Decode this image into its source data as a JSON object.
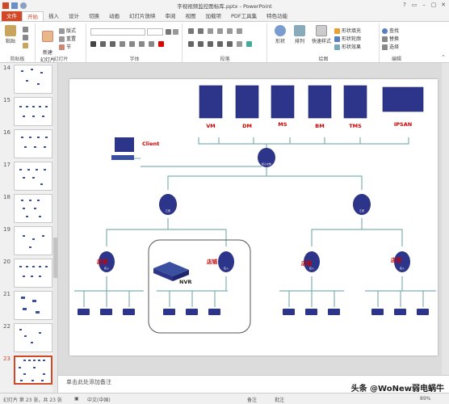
{
  "window": {
    "title": "字视视频监控图标库.pptx - PowerPoint",
    "controls": [
      "?",
      "▭",
      "–",
      "▢",
      "✕"
    ]
  },
  "tabs": [
    "文件",
    "开始",
    "插入",
    "设计",
    "切换",
    "动画",
    "幻灯片放映",
    "审阅",
    "视图",
    "加载项",
    "PDF工具集",
    "特色功能"
  ],
  "ribbon": {
    "clipboard": {
      "label": "剪贴板",
      "paste": "粘贴"
    },
    "slides": {
      "label": "幻灯片",
      "new_slide": "新建\n幻灯片",
      "layout": "版式",
      "reset": "重置",
      "section": "节"
    },
    "font": {
      "label": "字体"
    },
    "paragraph": {
      "label": "段落"
    },
    "drawing": {
      "label": "绘图",
      "shapes": "形状",
      "arrange": "排列",
      "quick_styles": "快速样式",
      "fill": "形状填充",
      "outline": "形状轮廓",
      "effect": "形状效果"
    },
    "editing": {
      "label": "编辑",
      "find": "查找",
      "replace": "替换",
      "select": "选择"
    }
  },
  "thumbnails": [
    "14",
    "15",
    "16",
    "17",
    "18",
    "19",
    "20",
    "21",
    "22",
    "23"
  ],
  "slide": {
    "servers": [
      "VM",
      "DM",
      "MS",
      "BM",
      "TMS",
      "IPSAN"
    ],
    "client": "Client",
    "nvr": "NVR",
    "store_label": "店铺",
    "switch_core": "核心交换",
    "switch_agg": "汇聚",
    "switch_access": "接入"
  },
  "notes": "单击此处添加备注",
  "status": {
    "slide": "幻灯片 第 23 张，共 23 张",
    "lang": "中文(中国)",
    "notes_btn": "备注",
    "comments_btn": "批注",
    "zoom": "89%"
  },
  "watermark": "头条 @WoNew弱电蜗牛",
  "colors": {
    "accent": "#d24726",
    "server": "#2c3589",
    "label_red": "#cc0000",
    "line": "#7fb0b0"
  }
}
